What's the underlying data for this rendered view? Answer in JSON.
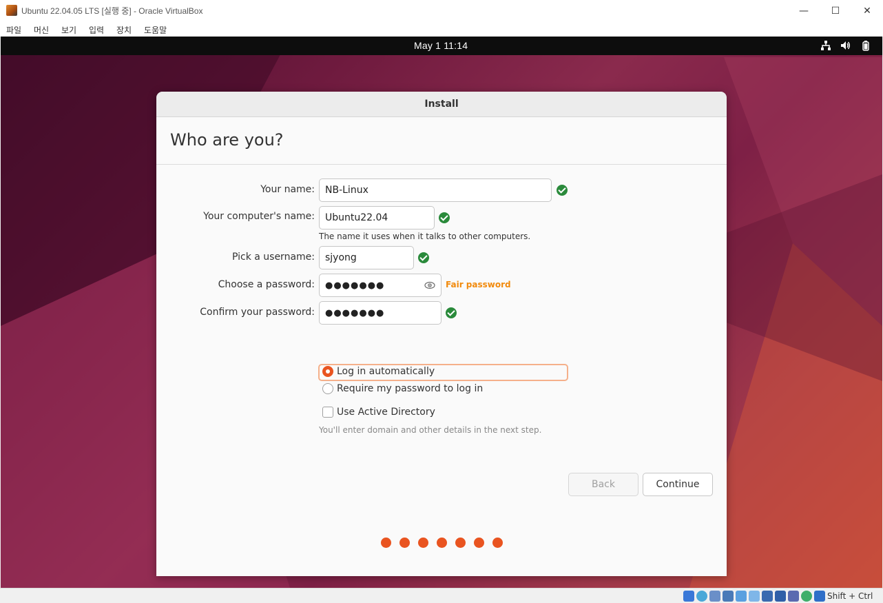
{
  "window": {
    "title": "Ubuntu 22.04.05 LTS [실행 중] - Oracle VirtualBox",
    "controls": [
      "—",
      "☐",
      "✕"
    ]
  },
  "menubar": {
    "items": [
      "파일",
      "머신",
      "보기",
      "입력",
      "장치",
      "도움말"
    ]
  },
  "vm_topbar": {
    "clock": "May 1  11:14",
    "tray_icons": [
      "network-icon",
      "volume-icon",
      "battery-icon"
    ]
  },
  "installer": {
    "header_title": "Install",
    "page_title": "Who are you?",
    "fields": {
      "your_name": {
        "label": "Your name:",
        "value": "NB-Linux"
      },
      "computer_name": {
        "label": "Your computer's name:",
        "value": "Ubuntu22.04",
        "hint": "The name it uses when it talks to other computers."
      },
      "username": {
        "label": "Pick a username:",
        "value": "sjyong"
      },
      "password": {
        "label": "Choose a password:",
        "value": "●●●●●●●",
        "strength": "Fair password"
      },
      "confirm_password": {
        "label": "Confirm your password:",
        "value": "●●●●●●●"
      }
    },
    "login_options": {
      "auto_login": {
        "label": "Log in automatically",
        "selected": true
      },
      "require_password": {
        "label": "Require my password to log in",
        "selected": false
      }
    },
    "active_directory": {
      "label": "Use Active Directory",
      "checked": false,
      "hint": "You'll enter domain and other details in the next step."
    },
    "buttons": {
      "back": "Back",
      "continue": "Continue"
    },
    "progress_steps": 7
  },
  "statusbar": {
    "host_key": "Shift + Ctrl"
  },
  "colors": {
    "accent": "#e95420",
    "ok_green": "#2a8a3b",
    "strength_orange": "#f18a0c"
  }
}
